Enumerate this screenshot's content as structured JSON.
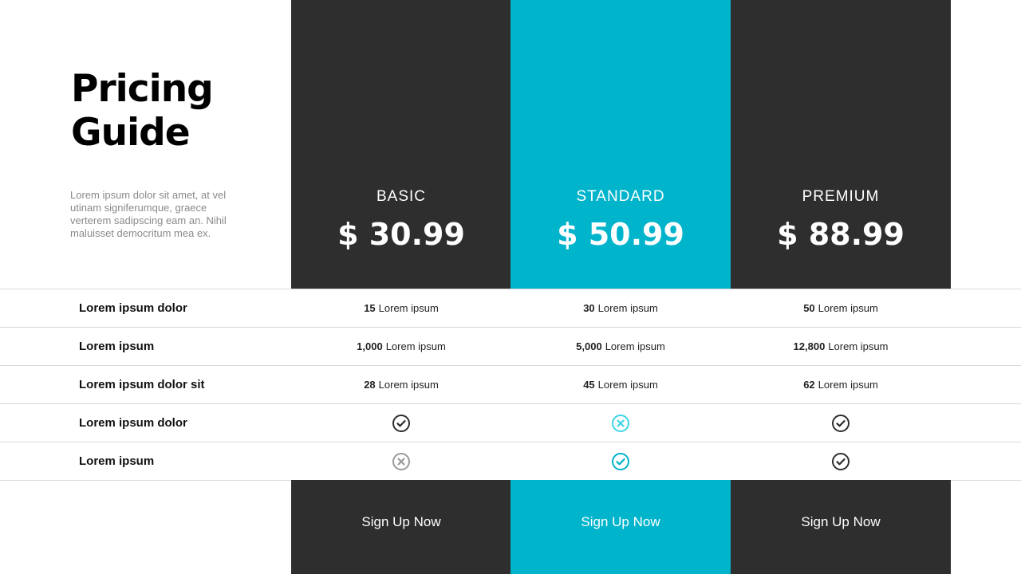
{
  "title_line1": "Pricing",
  "title_line2": "Guide",
  "description": "Lorem ipsum dolor sit amet, at vel utinam signiferumque, graece verterem sadipscing eam an. Nihil maluisset democritum mea ex.",
  "colors": {
    "dark": "#2e2e2e",
    "accent": "#00b4cc",
    "check_light": "#3fd4e4",
    "cross_gray": "#9a9a9a"
  },
  "plans": [
    {
      "name": "BASIC",
      "price": "$ 30.99",
      "button": "Sign Up Now"
    },
    {
      "name": "STANDARD",
      "price": "$ 50.99",
      "button": "Sign Up Now"
    },
    {
      "name": "PREMIUM",
      "price": "$ 88.99",
      "button": "Sign Up Now"
    }
  ],
  "features": [
    {
      "label": "Lorem ipsum dolor",
      "cells": [
        {
          "num": "15",
          "text": "Lorem ipsum"
        },
        {
          "num": "30",
          "text": "Lorem ipsum"
        },
        {
          "num": "50",
          "text": "Lorem ipsum"
        }
      ]
    },
    {
      "label": "Lorem ipsum",
      "cells": [
        {
          "num": "1,000",
          "text": "Lorem ipsum"
        },
        {
          "num": "5,000",
          "text": "Lorem ipsum"
        },
        {
          "num": "12,800",
          "text": "Lorem ipsum"
        }
      ]
    },
    {
      "label": "Lorem ipsum dolor sit",
      "cells": [
        {
          "num": "28",
          "text": "Lorem ipsum"
        },
        {
          "num": "45",
          "text": "Lorem ipsum"
        },
        {
          "num": "62",
          "text": "Lorem ipsum"
        }
      ]
    },
    {
      "label": "Lorem ipsum dolor",
      "icons": [
        "check-icon-dark",
        "cross-icon-cyan",
        "check-icon-dark"
      ]
    },
    {
      "label": "Lorem ipsum",
      "icons": [
        "cross-icon-gray",
        "check-icon-cyan",
        "check-icon-dark"
      ]
    }
  ]
}
